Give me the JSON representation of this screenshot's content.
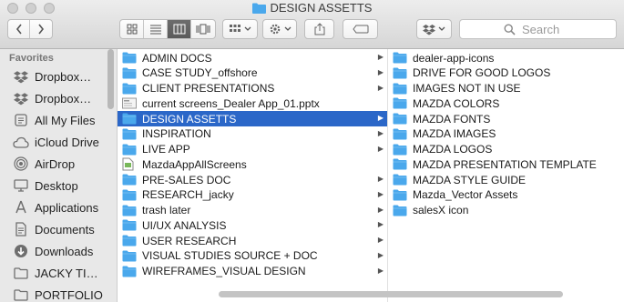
{
  "window": {
    "title": "DESIGN ASSETTS"
  },
  "toolbar": {
    "back_icon": "chevron-left-icon",
    "forward_icon": "chevron-right-icon",
    "view_modes": [
      "icon-view",
      "list-view",
      "column-view",
      "cover-flow-view"
    ],
    "active_view": "column-view",
    "search": {
      "placeholder": "Search"
    }
  },
  "sidebar": {
    "heading": "Favorites",
    "items": [
      {
        "label": "Dropbox…",
        "icon": "dropbox-icon"
      },
      {
        "label": "Dropbox…",
        "icon": "dropbox-icon"
      },
      {
        "label": "All My Files",
        "icon": "all-files-icon"
      },
      {
        "label": "iCloud Drive",
        "icon": "cloud-icon"
      },
      {
        "label": "AirDrop",
        "icon": "airdrop-icon"
      },
      {
        "label": "Desktop",
        "icon": "desktop-icon"
      },
      {
        "label": "Applications",
        "icon": "applications-icon"
      },
      {
        "label": "Documents",
        "icon": "document-icon"
      },
      {
        "label": "Downloads",
        "icon": "download-icon"
      },
      {
        "label": "JACKY TI…",
        "icon": "folder-icon"
      },
      {
        "label": "PORTFOLIO",
        "icon": "folder-icon"
      }
    ]
  },
  "column1": {
    "items": [
      {
        "label": "ADMIN DOCS",
        "type": "folder",
        "chevron": true
      },
      {
        "label": "CASE STUDY_offshore",
        "type": "folder",
        "chevron": true
      },
      {
        "label": "CLIENT PRESENTATIONS",
        "type": "folder",
        "chevron": true
      },
      {
        "label": "current screens_Dealer App_01.pptx",
        "type": "file",
        "chevron": false
      },
      {
        "label": "DESIGN ASSETTS",
        "type": "folder",
        "chevron": true,
        "selected": true
      },
      {
        "label": "INSPIRATION",
        "type": "folder",
        "chevron": true
      },
      {
        "label": "LIVE APP",
        "type": "folder",
        "chevron": true
      },
      {
        "label": "MazdaAppAllScreens",
        "type": "doc",
        "chevron": false
      },
      {
        "label": "PRE-SALES DOC",
        "type": "folder",
        "chevron": true
      },
      {
        "label": "RESEARCH_jacky",
        "type": "folder",
        "chevron": true
      },
      {
        "label": "trash later",
        "type": "folder",
        "chevron": true
      },
      {
        "label": "UI/UX ANALYSIS",
        "type": "folder",
        "chevron": true
      },
      {
        "label": "USER RESEARCH",
        "type": "folder",
        "chevron": true
      },
      {
        "label": "VISUAL STUDIES SOURCE + DOC",
        "type": "folder",
        "chevron": true
      },
      {
        "label": "WIREFRAMES_VISUAL DESIGN",
        "type": "folder",
        "chevron": true
      }
    ]
  },
  "column2": {
    "items": [
      {
        "label": "dealer-app-icons"
      },
      {
        "label": "DRIVE FOR GOOD LOGOS"
      },
      {
        "label": "IMAGES NOT IN USE"
      },
      {
        "label": "MAZDA COLORS"
      },
      {
        "label": "MAZDA FONTS"
      },
      {
        "label": "MAZDA IMAGES"
      },
      {
        "label": "MAZDA LOGOS"
      },
      {
        "label": "MAZDA PRESENTATION TEMPLATE"
      },
      {
        "label": "MAZDA STYLE GUIDE"
      },
      {
        "label": "Mazda_Vector Assets"
      },
      {
        "label": "salesX icon"
      }
    ]
  },
  "colors": {
    "selection": "#2b67c8",
    "folder": "#4aa8ec"
  }
}
